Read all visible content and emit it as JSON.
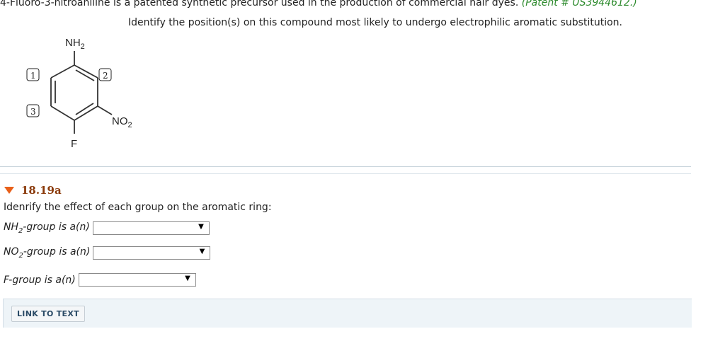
{
  "intro": {
    "text": "4-Fluoro-3-nitroaniline is a patented synthetic precursor used in the production of commercial hair dyes.",
    "patent": "(Patent # US3944612.)"
  },
  "instruction": "Identify the position(s) on this compound most likely to undergo electrophilic aromatic substitution.",
  "molecule": {
    "substituents": {
      "top": "NH2",
      "right": "NO2",
      "bottom": "F"
    },
    "positions": [
      "1",
      "2",
      "3"
    ]
  },
  "section": {
    "number": "18.19a",
    "question": "Idenrify the effect of each group on the aromatic ring:",
    "rows": [
      {
        "label_pre": "NH",
        "label_sub": "2",
        "label_post": "-group is a(n)",
        "value": ""
      },
      {
        "label_pre": "NO",
        "label_sub": "2",
        "label_post": "-group is a(n)",
        "value": ""
      },
      {
        "label_pre": "F-group is a(n)",
        "label_sub": "",
        "label_post": "",
        "value": ""
      }
    ]
  },
  "link_button": "LINK TO TEXT",
  "colors": {
    "accent": "#e8601a",
    "section_number": "#8a3a0a",
    "patent": "#2e8b2e",
    "link_bar": "#eef4f8"
  }
}
